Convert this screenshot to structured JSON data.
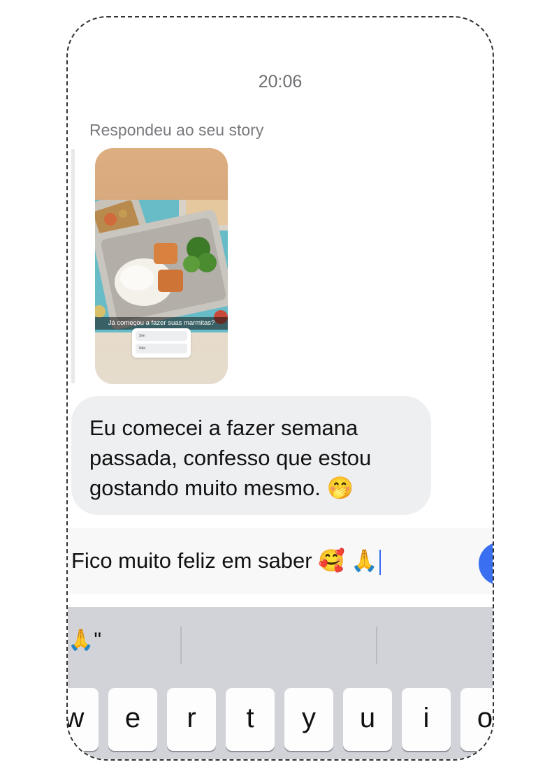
{
  "conversation": {
    "timestamp": "20:06",
    "reply_label": "Respondeu ao seu story",
    "story": {
      "caption": "Já começou a fazer suas marmitas?",
      "poll_options": [
        "Sim",
        "Não"
      ]
    },
    "message_text": "Eu comecei a fazer semana passada, confesso que estou gostando muito mesmo. 🤭"
  },
  "composer": {
    "value": "Fico muito feliz em saber 🥰 🙏",
    "send_icon": "send-icon"
  },
  "keyboard": {
    "suggestions": [
      "🙏\"",
      "",
      ""
    ],
    "keys": [
      "w",
      "e",
      "r",
      "t",
      "y",
      "u",
      "i",
      "o"
    ]
  }
}
